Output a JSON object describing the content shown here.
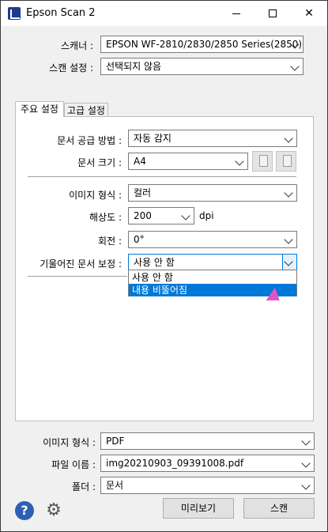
{
  "window": {
    "title": "Epson Scan 2",
    "minimize": "—",
    "maximize": "☐",
    "close": "✕"
  },
  "top": {
    "scanner_label": "스캐너 :",
    "scanner_value": "EPSON WF-2810/2830/2850 Series(2850)",
    "scan_settings_label": "스캔 설정 :",
    "scan_settings_value": "선택되지 않음"
  },
  "tabs": [
    "주요 설정",
    "고급 설정"
  ],
  "main": {
    "doc_source_label": "문서 공급 방법 :",
    "doc_source_value": "자동 감지",
    "doc_size_label": "문서 크기 :",
    "doc_size_value": "A4",
    "image_type_label": "이미지 형식 :",
    "image_type_value": "컬러",
    "resolution_label": "해상도 :",
    "resolution_value": "200",
    "resolution_unit": "dpi",
    "rotate_label": "회전 :",
    "rotate_value": "0°",
    "skew_label": "기울어진 문서 보정 :",
    "skew_value": "사용 안 함",
    "skew_options": [
      "사용 안 함",
      "내용 비뚤어짐"
    ]
  },
  "bottom": {
    "image_format_label": "이미지 형식 :",
    "image_format_value": "PDF",
    "file_name_label": "파일 이름 :",
    "file_name_value": "img20210903_09391008.pdf",
    "folder_label": "폴더 :",
    "folder_value": "문서",
    "preview_label": "미리보기",
    "scan_label": "스캔",
    "help_glyph": "?",
    "gear_glyph": "⚙"
  },
  "colors": {
    "accent": "#0078d7",
    "help_icon": "#2f5fb4",
    "cursor": "#e055c6"
  }
}
